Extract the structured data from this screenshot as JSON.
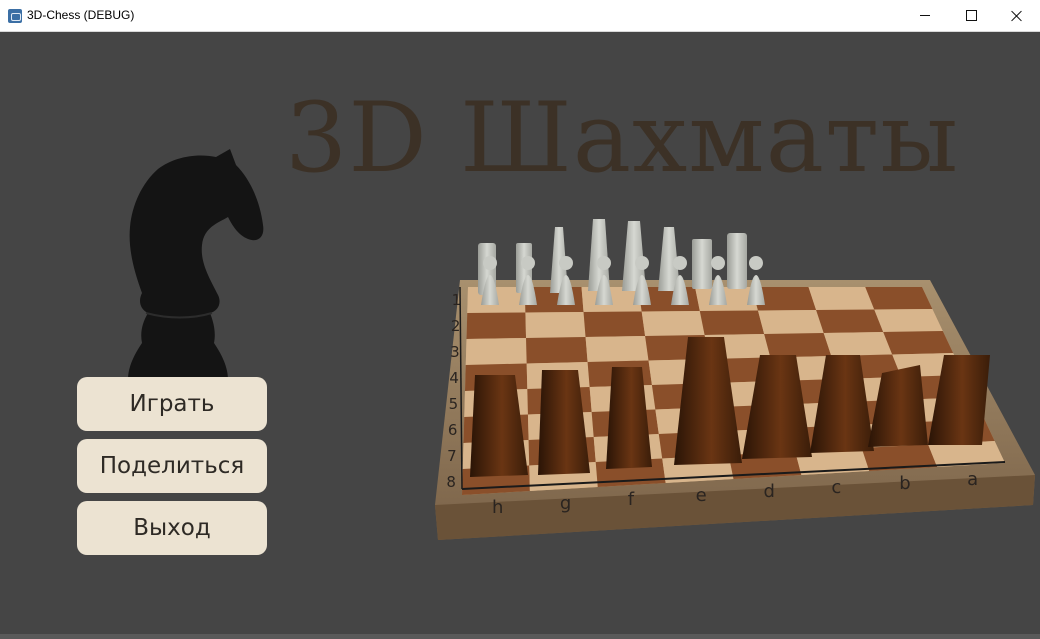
{
  "window": {
    "title": "3D-Chess (DEBUG)",
    "controls": {
      "minimize": "minimize-icon",
      "maximize": "maximize-icon",
      "close": "close-icon"
    }
  },
  "game": {
    "title": "3D Шахматы"
  },
  "menu": {
    "play_label": "Играть",
    "share_label": "Поделиться",
    "exit_label": "Выход"
  },
  "board": {
    "rank_labels": [
      "1",
      "2",
      "3",
      "4",
      "5",
      "6",
      "7",
      "8"
    ],
    "file_labels": [
      "h",
      "g",
      "f",
      "e",
      "d",
      "c",
      "b",
      "a"
    ]
  },
  "colors": {
    "background": "#454545",
    "title_text": "#3c3126",
    "button_bg": "#ece3d2",
    "button_text": "#2e2a25"
  }
}
